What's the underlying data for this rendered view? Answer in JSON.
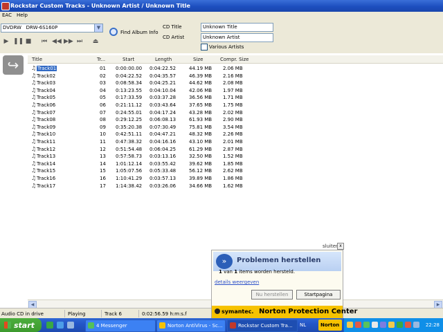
{
  "window": {
    "app_name": "Rockstar Custom Tracks",
    "separator": " - ",
    "document_title": "Unknown Artist / Unknown Title"
  },
  "menu": [
    "EAC",
    "Help"
  ],
  "toolbar": {
    "drive_combo_value": "DVDRW   DRW-6S160P",
    "find_album_label": "Find Album Info",
    "cd_title_label": "CD Title",
    "cd_title_value": "Unknown Title",
    "cd_artist_label": "CD Artist",
    "cd_artist_value": "Unknown Artist",
    "various_artists_label": "Various Artists",
    "various_artists_checked": false
  },
  "table": {
    "columns": [
      "Title",
      "Tr...",
      "Start",
      "Length",
      "Size",
      "Compr. Size"
    ],
    "selected_row": 0,
    "rows": [
      [
        "Track01",
        "01",
        "0:00:00.00",
        "0:04:22.52",
        "44.19 MB",
        "2.06 MB"
      ],
      [
        "Track02",
        "02",
        "0:04:22.52",
        "0:04:35.57",
        "46.39 MB",
        "2.16 MB"
      ],
      [
        "Track03",
        "03",
        "0:08:58.34",
        "0:04:25.21",
        "44.62 MB",
        "2.08 MB"
      ],
      [
        "Track04",
        "04",
        "0:13:23.55",
        "0:04:10.04",
        "42.06 MB",
        "1.97 MB"
      ],
      [
        "Track05",
        "05",
        "0:17:33.59",
        "0:03:37.28",
        "36.56 MB",
        "1.71 MB"
      ],
      [
        "Track06",
        "06",
        "0:21:11.12",
        "0:03:43.64",
        "37.65 MB",
        "1.75 MB"
      ],
      [
        "Track07",
        "07",
        "0:24:55.01",
        "0:04:17.24",
        "43.28 MB",
        "2.02 MB"
      ],
      [
        "Track08",
        "08",
        "0:29:12.25",
        "0:06:08.13",
        "61.93 MB",
        "2.90 MB"
      ],
      [
        "Track09",
        "09",
        "0:35:20.38",
        "0:07:30.49",
        "75.81 MB",
        "3.54 MB"
      ],
      [
        "Track10",
        "10",
        "0:42:51.11",
        "0:04:47.21",
        "48.32 MB",
        "2.26 MB"
      ],
      [
        "Track11",
        "11",
        "0:47:38.32",
        "0:04:16.16",
        "43.10 MB",
        "2.01 MB"
      ],
      [
        "Track12",
        "12",
        "0:51:54.48",
        "0:06:04.25",
        "61.29 MB",
        "2.87 MB"
      ],
      [
        "Track13",
        "13",
        "0:57:58.73",
        "0:03:13.16",
        "32.50 MB",
        "1.52 MB"
      ],
      [
        "Track14",
        "14",
        "1:01:12.14",
        "0:03:55.42",
        "39.62 MB",
        "1.85 MB"
      ],
      [
        "Track15",
        "15",
        "1:05:07.56",
        "0:05:33.48",
        "56.12 MB",
        "2.62 MB"
      ],
      [
        "Track16",
        "16",
        "1:10:41.29",
        "0:03:57.13",
        "39.89 MB",
        "1.86 MB"
      ],
      [
        "Track17",
        "17",
        "1:14:38.42",
        "0:03:26.06",
        "34.66 MB",
        "1.62 MB"
      ]
    ]
  },
  "statusbar": {
    "drive_status": "Audio CD in drive",
    "play_state": "Playing",
    "current_track": "Track 6",
    "time": "0:02:56.59 h:m:s.f"
  },
  "taskbar": {
    "start_label": "start",
    "tasks": [
      {
        "label": "4 Messenger",
        "active": false
      },
      {
        "label": "Norton AntiVirus - Sc...",
        "active": false
      },
      {
        "label": "Rockstar Custom Tra...",
        "active": true
      }
    ],
    "language": "NL",
    "norton_label": "Norton",
    "clock": "22:28"
  },
  "popup": {
    "close_label": "sluiten",
    "close_glyph": "x",
    "title": "Problemen herstellen",
    "message_count_a": "1",
    "message_mid": " van ",
    "message_count_b": "1",
    "message_tail": " items worden hersteld.",
    "details_link": "details weergeven",
    "repair_button": "Nu herstellen",
    "home_button": "Startpagina",
    "brand": "symantec.",
    "product": "Norton Protection Center"
  },
  "colors": {
    "selection": "#316ac5",
    "titlebar": "#1d4fbf",
    "norton_yellow": "#f6c200"
  }
}
